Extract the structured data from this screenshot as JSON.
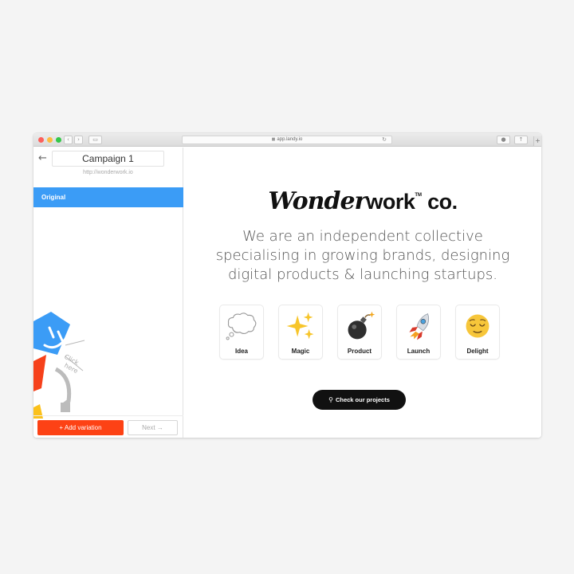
{
  "browser": {
    "url": "app.landy.io",
    "lock_icon": "lock-icon",
    "reload_glyph": "↻",
    "back_glyph": "‹",
    "forward_glyph": "›",
    "sidebar_glyph": "▭",
    "download_glyph": "●",
    "share_glyph": "↑",
    "new_tab_glyph": "+"
  },
  "sidebar": {
    "back_glyph": "←",
    "campaign_name": "Campaign 1",
    "campaign_url": "http://wonderwork.io",
    "variations": [
      {
        "label": "Original",
        "selected": true
      }
    ],
    "doodle_text": [
      "Click",
      "here"
    ],
    "add_variation_label": "+  Add variation",
    "next_label": "Next →",
    "colors": {
      "selected": "#3b9cf6",
      "add_button": "#fd4215"
    }
  },
  "main": {
    "logo_script": "Wonder",
    "logo_sans": "work",
    "logo_tm": "TM",
    "logo_suffix": " co.",
    "tagline_lines": [
      "We are an independent collective",
      "specialising in growing brands, designing",
      "digital products & launching startups."
    ],
    "cards": [
      {
        "label": "Idea",
        "icon": "thought-bubble-icon"
      },
      {
        "label": "Magic",
        "icon": "sparkles-icon"
      },
      {
        "label": "Product",
        "icon": "bomb-icon"
      },
      {
        "label": "Launch",
        "icon": "rocket-icon"
      },
      {
        "label": "Delight",
        "icon": "relieved-face-icon"
      }
    ],
    "cta_label": "Check our projects",
    "cta_icon": "map-pin-icon"
  }
}
